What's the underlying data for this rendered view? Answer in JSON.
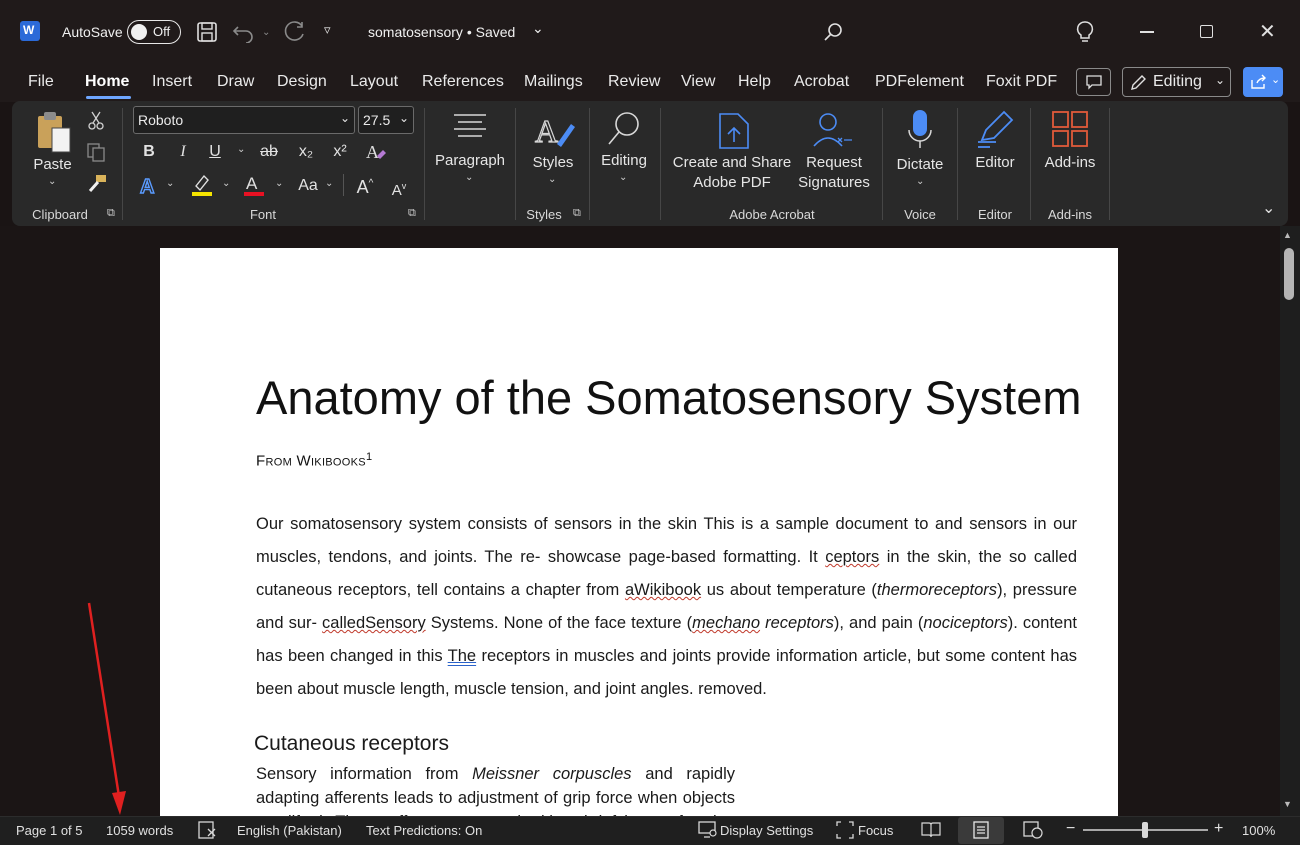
{
  "window": {
    "app_icon_letter": "W",
    "autosave_label": "AutoSave",
    "autosave_state": "Off",
    "doc_title": "somatosensory • Saved"
  },
  "menu": {
    "tabs": [
      "File",
      "Home",
      "Insert",
      "Draw",
      "Design",
      "Layout",
      "References",
      "Mailings",
      "Review",
      "View",
      "Help",
      "Acrobat",
      "PDFelement",
      "Foxit PDF"
    ],
    "active_tab": "Home",
    "editing_mode": "Editing"
  },
  "ribbon": {
    "clipboard": {
      "paste_label": "Paste",
      "group_label": "Clipboard"
    },
    "font": {
      "font_name": "Roboto",
      "font_size": "27.5",
      "bold": "B",
      "italic": "I",
      "underline": "U",
      "strike": "ab",
      "subscript": "x₂",
      "superscript": "x²",
      "change_case": "Aa",
      "group_label": "Font"
    },
    "paragraph": {
      "label": "Paragraph"
    },
    "styles": {
      "label": "Styles",
      "group_label": "Styles"
    },
    "editing": {
      "label": "Editing"
    },
    "acrobat": {
      "create_share_line1": "Create and Share",
      "create_share_line2": "Adobe PDF",
      "request_line1": "Request",
      "request_line2": "Signatures",
      "group_label": "Adobe Acrobat"
    },
    "voice": {
      "dictate_label": "Dictate",
      "group_label": "Voice"
    },
    "editor": {
      "label": "Editor",
      "group_label": "Editor"
    },
    "addins": {
      "label": "Add-ins",
      "group_label": "Add-ins"
    }
  },
  "document": {
    "title": "Anatomy of the Somatosensory System",
    "subtitle": "From Wikibooks",
    "subtitle_footnote": "1",
    "heading2": "Cutaneous receptors"
  },
  "status": {
    "page": "Page 1 of 5",
    "words": "1059 words",
    "language": "English (Pakistan)",
    "text_predictions": "Text Predictions: On",
    "display_settings": "Display Settings",
    "focus": "Focus",
    "zoom": "100%"
  },
  "colors": {
    "accent_blue": "#6ea6ff",
    "share_button": "#4c8cf5",
    "font_color_red": "#e81123",
    "highlight_yellow": "#f5e400",
    "annotation_arrow": "#e02020",
    "addins_icon": "#e05a3a"
  }
}
